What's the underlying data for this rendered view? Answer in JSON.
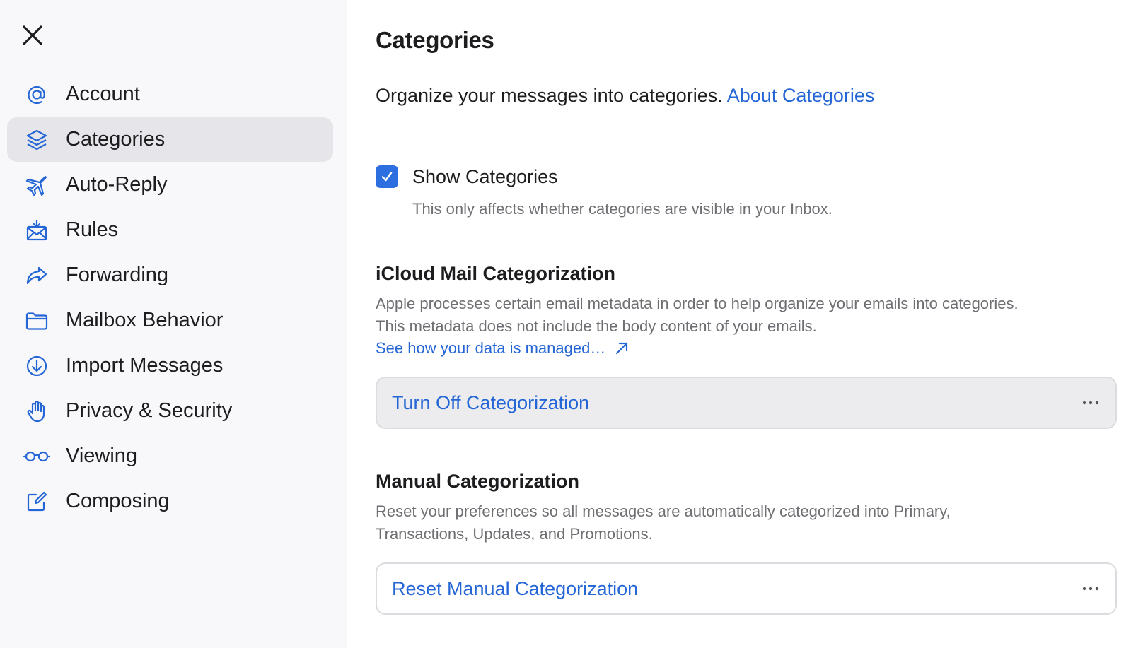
{
  "sidebar": {
    "items": [
      {
        "label": "Account",
        "icon": "at-icon",
        "active": false
      },
      {
        "label": "Categories",
        "icon": "layers-icon",
        "active": true
      },
      {
        "label": "Auto-Reply",
        "icon": "airplane-icon",
        "active": false
      },
      {
        "label": "Rules",
        "icon": "envelope-rules-icon",
        "active": false
      },
      {
        "label": "Forwarding",
        "icon": "forward-arrow-icon",
        "active": false
      },
      {
        "label": "Mailbox Behavior",
        "icon": "folder-icon",
        "active": false
      },
      {
        "label": "Import Messages",
        "icon": "download-circle-icon",
        "active": false
      },
      {
        "label": "Privacy & Security",
        "icon": "hand-icon",
        "active": false
      },
      {
        "label": "Viewing",
        "icon": "glasses-icon",
        "active": false
      },
      {
        "label": "Composing",
        "icon": "compose-icon",
        "active": false
      }
    ]
  },
  "main": {
    "title": "Categories",
    "intro_text": "Organize your messages into categories.",
    "intro_link": "About Categories",
    "show_categories": {
      "label": "Show Categories",
      "checked": true,
      "help": "This only affects whether categories are visible in your Inbox."
    },
    "icloud": {
      "title": "iCloud Mail Categorization",
      "line1": "Apple processes certain email metadata in order to help organize your emails into categories.",
      "line2": "This metadata does not include the body content of your emails.",
      "link": "See how your data is managed…",
      "action": "Turn Off Categorization"
    },
    "manual": {
      "title": "Manual Categorization",
      "line1": "Reset your preferences so all messages are automatically categorized into Primary,",
      "line2": "Transactions, Updates, and Promotions.",
      "action": "Reset Manual Categorization"
    }
  },
  "colors": {
    "accent": "#2566d6",
    "checkbox": "#2d6fe0",
    "sidebar_bg": "#f8f8fa",
    "active_item_bg": "#e6e6ea",
    "secondary_text": "#6e6e73"
  }
}
